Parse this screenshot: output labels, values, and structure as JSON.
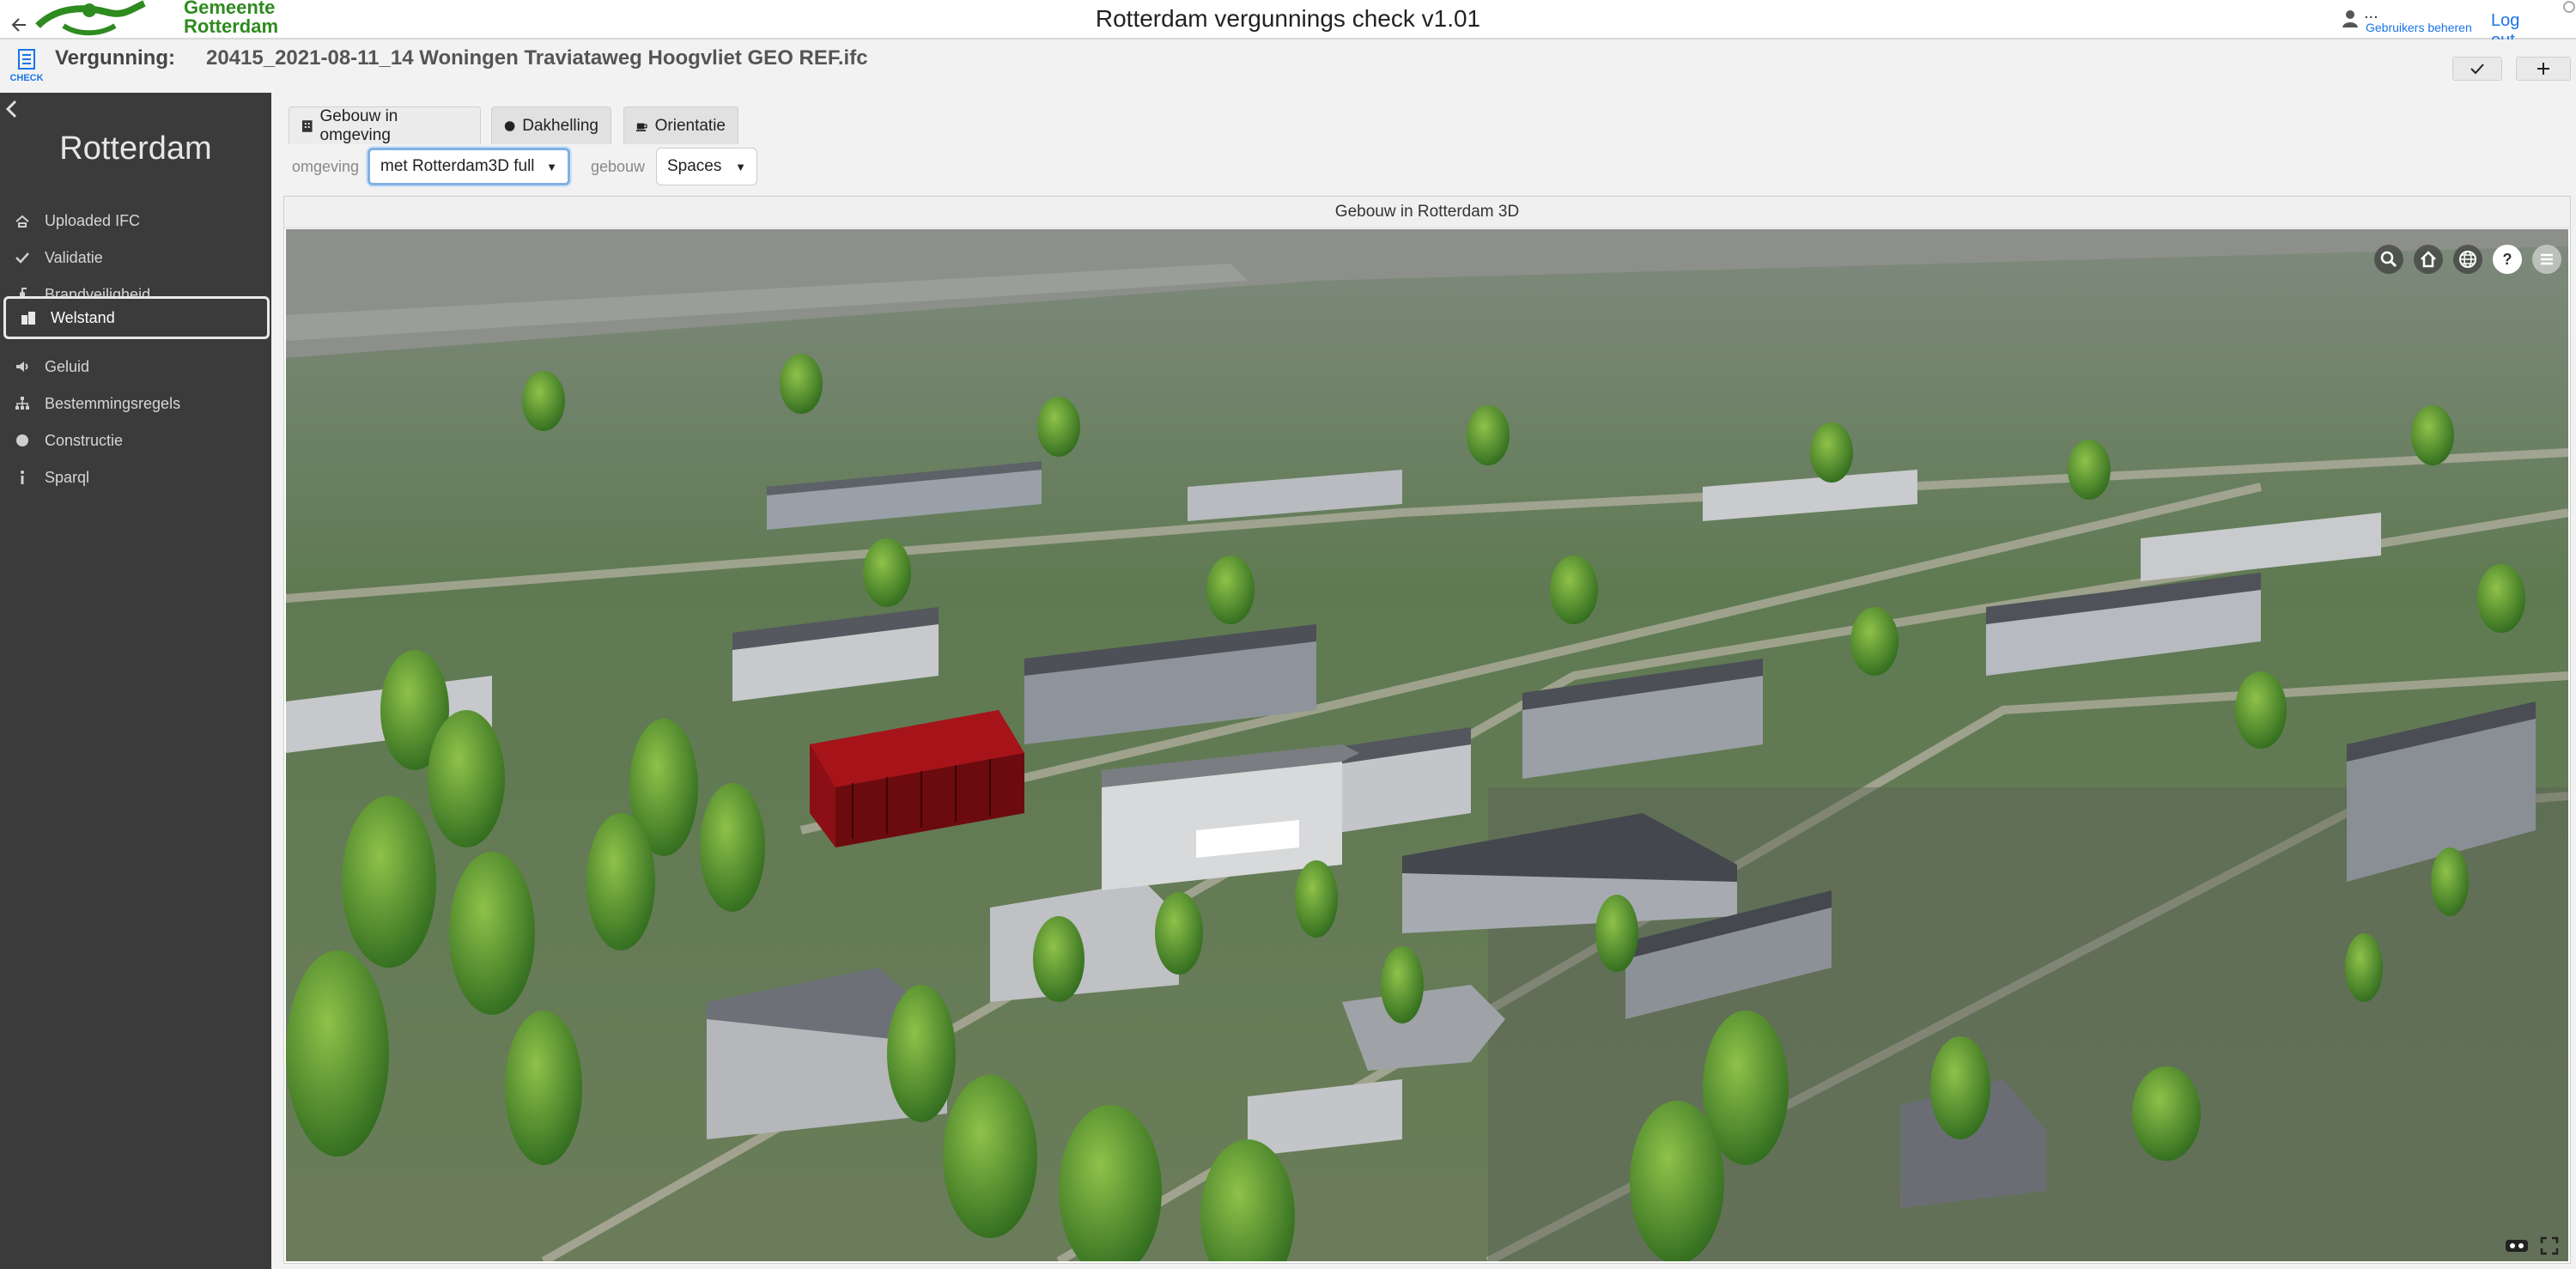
{
  "header": {
    "logo_text_line1": "Gemeente",
    "logo_text_line2": "Rotterdam",
    "title": "Rotterdam vergunnings check v1.01",
    "user_name": "...",
    "users_link": "Gebruikers beheren",
    "logout": "Log out"
  },
  "permit": {
    "check_logo": "CHECK",
    "label": "Vergunning:",
    "file": "20415_2021-08-11_14 Woningen Traviataweg Hoogvliet GEO REF.ifc",
    "approve_icon": "check-icon",
    "add_icon": "plus-icon"
  },
  "sidebar": {
    "title": "Rotterdam",
    "items": [
      {
        "label": "Uploaded IFC",
        "icon": "upload-icon"
      },
      {
        "label": "Validatie",
        "icon": "check-icon"
      },
      {
        "label": "Brandveiligheid",
        "icon": "fire-extinguisher-icon"
      },
      {
        "label": "Welstand",
        "icon": "buildings-icon",
        "active": true
      },
      {
        "label": "Geluid",
        "icon": "speaker-icon"
      },
      {
        "label": "Bestemmingsregels",
        "icon": "sitemap-icon"
      },
      {
        "label": "Constructie",
        "icon": "circle-icon"
      },
      {
        "label": "Sparql",
        "icon": "info-icon"
      }
    ]
  },
  "tabs": [
    {
      "label": "Gebouw in omgeving",
      "icon": "building-icon",
      "active": true
    },
    {
      "label": "Dakhelling",
      "icon": "circle-icon"
    },
    {
      "label": "Orientatie",
      "icon": "coffee-icon"
    }
  ],
  "filters": {
    "omgeving_label": "omgeving",
    "omgeving_value": "met Rotterdam3D full",
    "gebouw_label": "gebouw",
    "gebouw_value": "Spaces"
  },
  "viewer": {
    "title": "Gebouw in Rotterdam 3D",
    "toolbar": [
      "search-icon",
      "home-icon",
      "globe-icon",
      "help-icon",
      "menu-icon"
    ],
    "bottom_controls": [
      "vr-icon",
      "fullscreen-icon"
    ],
    "highlight_color": "#8b0f14"
  },
  "colors": {
    "sidebar_bg": "#3b3b3b",
    "brand_green": "#2e8b1f",
    "link_blue": "#1a73e8"
  }
}
